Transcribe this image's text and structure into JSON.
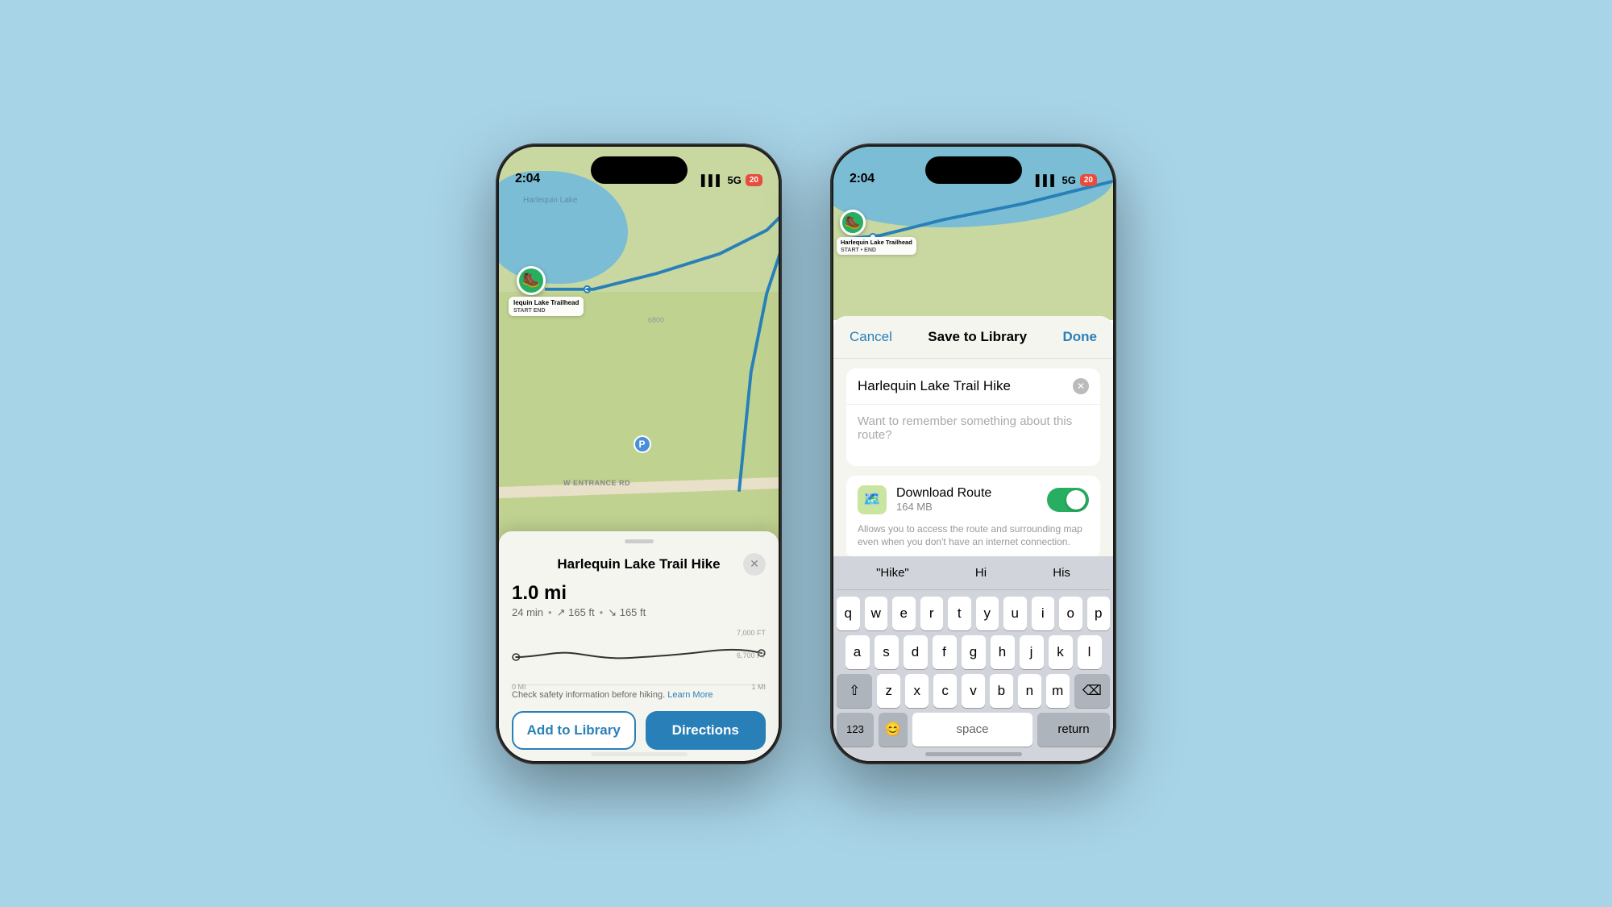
{
  "background_color": "#a8d4e8",
  "phone1": {
    "status": {
      "time": "2:04",
      "signal": "5G",
      "battery": "20"
    },
    "map": {
      "lake_label": "Harlequin Lake",
      "road_label": "W ENTRANCE RD",
      "contour_label": "6800",
      "trailhead_label": "lequin Lake Trailhead",
      "start_end_label": "START END"
    },
    "sheet": {
      "title": "Harlequin Lake Trail Hike",
      "distance": "1.0 mi",
      "time": "24 min",
      "gain": "165 ft",
      "loss": "165 ft",
      "elev_high": "7,000 FT",
      "elev_low": "6,700 FT",
      "mi_start": "0 MI",
      "mi_end": "1 MI",
      "safety_text": "Check safety information before hiking.",
      "learn_more": "Learn More",
      "btn_library": "Add to Library",
      "btn_directions": "Directions"
    }
  },
  "phone2": {
    "status": {
      "time": "2:04",
      "signal": "5G",
      "battery": "20"
    },
    "map": {
      "trailhead_label": "Harlequin Lake Trailhead",
      "start_end_label": "START • END"
    },
    "save_sheet": {
      "cancel": "Cancel",
      "title": "Save to Library",
      "done": "Done",
      "route_name": "Harlequin Lake Trail Hike",
      "notes_placeholder": "Want to remember something about this route?",
      "download_title": "Download Route",
      "download_size": "164 MB",
      "download_desc": "Allows you to access the route and surrounding map even when you don't have an internet connection.",
      "toggle_on": true
    },
    "keyboard": {
      "suggestions": [
        "\"Hike\"",
        "Hi",
        "His"
      ],
      "row1": [
        "q",
        "w",
        "e",
        "r",
        "t",
        "y",
        "u",
        "i",
        "o",
        "p"
      ],
      "row2": [
        "a",
        "s",
        "d",
        "f",
        "g",
        "h",
        "j",
        "k",
        "l"
      ],
      "row3": [
        "z",
        "x",
        "c",
        "v",
        "b",
        "n",
        "m"
      ],
      "numbers_label": "123",
      "return_label": "return"
    }
  }
}
